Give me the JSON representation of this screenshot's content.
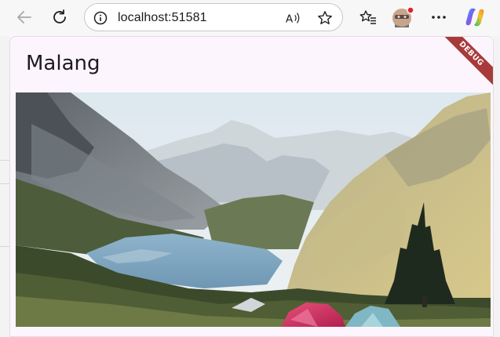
{
  "browser": {
    "url": "localhost:51581",
    "icons": {
      "back": "arrow-left-icon",
      "reload": "reload-icon",
      "site_info": "info-icon",
      "read_aloud": "read-aloud-icon",
      "favorite": "star-icon",
      "favorites_list": "favorites-icon",
      "profile": "avatar",
      "menu": "more-icon",
      "copilot": "copilot-icon"
    },
    "colors": {
      "toolbar_bg": "#f7f7f7",
      "profile_badge": "#e0202a"
    }
  },
  "app": {
    "title": "Malang",
    "debug_label": "DEBUG",
    "colors": {
      "background": "#fdf5fd",
      "debug_banner": "#a83a3a"
    },
    "image": {
      "subject": "mountain-lake-landscape"
    }
  }
}
